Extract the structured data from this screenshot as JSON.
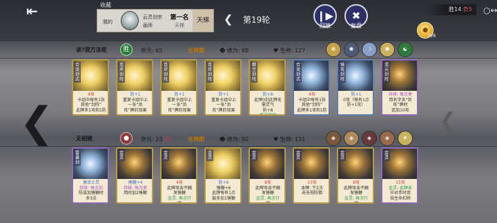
{
  "top": {
    "back_icon": "back-arrow-icon",
    "collect": "收藏",
    "player_panel": {
      "label": "我的",
      "name": "云灵剑宗",
      "sect": "画师",
      "rank": "第一名",
      "rank_sub": "天梯",
      "tier": "天梯"
    },
    "round_label": "第19轮",
    "replay_label": "回放",
    "review_label": "复盘",
    "score_wins": "胜14",
    "score_losses": "负5",
    "coin_count": "8/8"
  },
  "player_top": {
    "name": "读?我万法呢",
    "badge": "胜",
    "mingyuan_label": "命元:",
    "mingyuan_value": "65",
    "stage": "化神期",
    "xiuwei_label": "修为:",
    "xiuwei_value": "88",
    "hp_label": "生命:",
    "hp_value": "127",
    "relic_colors": [
      "#c3a24a",
      "#4f5b76",
      "#8aa0c8",
      "#c9b15e",
      "#2b7b3d"
    ]
  },
  "player_bottom": {
    "name": "无相猪",
    "mingyuan_label": "命元:",
    "mingyuan_value": "23",
    "mingyuan_max": "35",
    "stage": "化神期",
    "xiuwei_label": "修为:",
    "xiuwei_value": "92",
    "hp_label": "生命:",
    "hp_value": "131",
    "relic_colors": [
      "#7a5a3a",
      "#b08a5a",
      "#6a3a3a",
      "#9a6a4a",
      "#c9b15e"
    ]
  },
  "top_cards": [
    {
      "title": "合流剑式",
      "text": [
        "4攻",
        "卡组中每有1张",
        "其他“剑阵”",
        "此牌多1攻和1防"
      ],
      "style": "gold",
      "border": "gold"
    },
    {
      "title": "连环剑阵",
      "text": [
        "防+1",
        "重复卡组中上",
        "一张“剑",
        "阵”牌的效果"
      ],
      "style": "gold",
      "border": "gold"
    },
    {
      "title": "连环剑阵",
      "text": [
        "防+1",
        "重复卡组中上",
        "一张“剑",
        "阵”牌的效果"
      ],
      "style": "gold",
      "border": "gold"
    },
    {
      "title": "连环剑阵",
      "text": [
        "防+1",
        "重复卡组中上",
        "一张“剑",
        "阵”牌的效果"
      ],
      "style": "gold",
      "border": "gold"
    },
    {
      "title": "御空剑阵",
      "text": [
        "防+8",
        "此牌0剑此牌无",
        "需灵气",
        "防+8",
        "再次行动"
      ],
      "style": "gold",
      "border": "gold"
    },
    {
      "title": "合流剑式",
      "text": [
        "4攻",
        "卡组中每有1张",
        "其他“剑阵”",
        "此牌多1攻和1防"
      ],
      "style": "teal",
      "border": "blue"
    },
    {
      "title": "镜花剑阵",
      "text": [
        "防+1",
        "0攻（每有1点",
        "防+1攻）"
      ],
      "style": "teal",
      "border": "blue"
    },
    {
      "title": "混元剑阵",
      "text": [
        "持续: 每次使",
        "用名字含“剑",
        "阵”牌时",
        "追加10攻"
      ],
      "style": "dark",
      "border": "purple"
    }
  ],
  "bottom_cards": [
    {
      "title": "雷暴剑",
      "text": [
        "激活土灵",
        "持续: 每次加",
        "防或加锤鞭时",
        "多3点"
      ],
      "style": "teal",
      "border": "purple"
    },
    {
      "title": "金灵",
      "text": [
        "锤鞭+4",
        "持续: 每次使",
        "用时加2锤鞭"
      ],
      "style": "dark",
      "border": "gold"
    },
    {
      "title": "金灵",
      "text": [
        "4攻",
        "此牌攻击不触",
        "发锤鞭",
        "金灵: 再次行",
        "动"
      ],
      "style": "dark",
      "border": "gold"
    },
    {
      "title": "金灵",
      "text": [
        "防+6",
        "锤鞭+6",
        "此牌每有1点",
        "鼓多加1锤鞭"
      ],
      "style": "gold",
      "border": "gold"
    },
    {
      "title": "金灵",
      "text": [
        "8攻",
        "此牌攻击不触",
        "发锤鞭",
        "金灵: 再次行",
        "动"
      ],
      "style": "dark",
      "border": "gold"
    },
    {
      "title": "金灵",
      "text": [
        "13攻",
        "本牌: 下2次",
        "击无视防御"
      ],
      "style": "dark",
      "border": "gold"
    },
    {
      "title": "金灵",
      "text": [
        "8攻",
        "此牌攻击不触",
        "发锤鞭",
        "金灵: 再次行",
        "动"
      ],
      "style": "dark",
      "border": "gold"
    },
    {
      "title": "金灵",
      "text": [
        "15攻",
        "金灵: 此牌击",
        "中对手时双",
        "倍生命扣除"
      ],
      "style": "dark",
      "border": "purple"
    }
  ]
}
